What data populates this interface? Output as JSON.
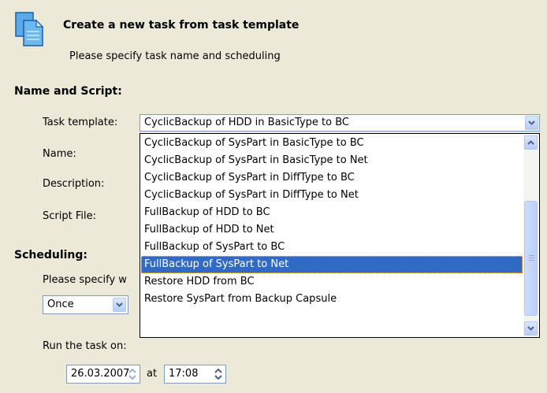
{
  "header": {
    "title": "Create a new task from task template",
    "subtitle": "Please specify task name and scheduling"
  },
  "name_script": {
    "section_label": "Name and Script:",
    "task_template_label": "Task template:",
    "task_template_value": "CyclicBackup of HDD in BasicType to BC",
    "name_label": "Name:",
    "description_label": "Description:",
    "script_file_label": "Script File:"
  },
  "dropdown": {
    "items": [
      "CyclicBackup of SysPart in BasicType to BC",
      "CyclicBackup of SysPart in BasicType to Net",
      "CyclicBackup of SysPart in DiffType to BC",
      "CyclicBackup of SysPart in DiffType to Net",
      "FullBackup of HDD to BC",
      "FullBackup of HDD to Net",
      "FullBackup of SysPart to BC",
      "FullBackup of SysPart to Net",
      "Restore HDD from BC",
      "Restore SysPart from Backup Capsule"
    ],
    "selected_index": 7
  },
  "scheduling": {
    "section_label": "Scheduling:",
    "specify_label": "Please specify w",
    "frequency_value": "Once",
    "run_label": "Run the task on:",
    "date_value": "26.03.2007",
    "at_label": "at",
    "time_value": "17:08"
  },
  "colors": {
    "background": "#ece9d8",
    "selection": "#316ac5",
    "border": "#7f9db9"
  }
}
